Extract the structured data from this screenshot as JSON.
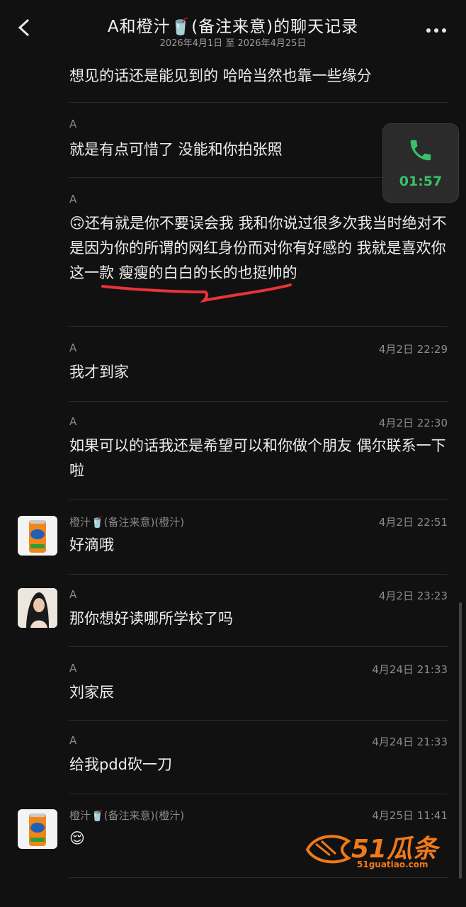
{
  "header": {
    "back_icon": "chevron-left-icon",
    "title": "A和橙汁🥤(备注来意)的聊天记录",
    "date_range": "2026年4月1日 至 2026年4月25日",
    "more_icon": "more-icon"
  },
  "call_widget": {
    "duration": "01:57",
    "icon": "phone-icon"
  },
  "messages": [
    {
      "sender": "",
      "time": "",
      "text": "想见的话还是能见到的 哈哈当然也靠一些缘分"
    },
    {
      "sender": "A",
      "time": "",
      "text": "就是有点可惜了 没能和你拍张照"
    },
    {
      "sender": "A",
      "time": "",
      "text": "🙃还有就是你不要误会我 我和你说过很多次我当时绝对不是因为你的所谓的网红身份而对你有好感的 我就是喜欢你这一款 瘦瘦的白白的长的也挺帅的"
    },
    {
      "sender": "A",
      "time": "4月2日 22:29",
      "text": "我才到家"
    },
    {
      "sender": "A",
      "time": "4月2日 22:30",
      "text": "如果可以的话我还是希望可以和你做个朋友 偶尔联系一下啦"
    },
    {
      "sender": "橙汁🥤(备注来意)(橙汁)",
      "time": "4月2日 22:51",
      "text": "好滴哦"
    },
    {
      "sender": "A",
      "time": "4月2日 23:23",
      "text": "那你想好读哪所学校了吗"
    },
    {
      "sender": "A",
      "time": "4月24日 21:33",
      "text": "刘家辰"
    },
    {
      "sender": "A",
      "time": "4月24日 21:33",
      "text": "给我pdd砍一刀"
    },
    {
      "sender": "橙汁🥤(备注来意)(橙汁)",
      "time": "4月25日 11:41",
      "text": "😌"
    }
  ],
  "watermark": {
    "brand": "51瓜条",
    "url": "51guatiao.com"
  },
  "colors": {
    "background": "#111111",
    "call_green": "#39c06a",
    "highlight_underline": "#e8333a",
    "watermark": "#f07a1a"
  }
}
